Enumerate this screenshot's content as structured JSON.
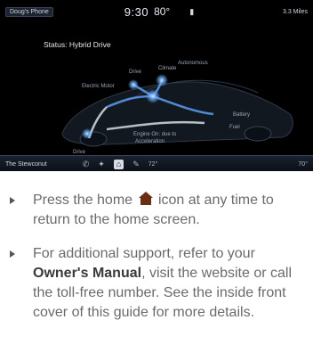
{
  "screen": {
    "top_left": "Doug's Phone",
    "time": "9:30",
    "temp": "80°",
    "top_right": "3.3 Miles",
    "status": "Status: Hybrid Drive",
    "labels": {
      "autonomy": "Autonomous",
      "drive": "Drive",
      "climate": "Climate",
      "electric_motor": "Electric Motor",
      "battery": "Battery",
      "fuel": "Fuel",
      "wheels": "Drive",
      "engine_note_1": "Engine On: due to",
      "engine_note_2": "Acceleration"
    },
    "bottom_left": "The Stewconut",
    "bottom_temp": "72°",
    "bottom_right": "70°"
  },
  "bullets": {
    "b1_before": "Press the home",
    "b1_after": "icon at any time to return to the home screen.",
    "b2_before": "For additional support, refer to your",
    "b2_bold": "Owner's Manual",
    "b2_after": ", visit the website or call the toll-free number. See the inside front cover of this guide for more details."
  },
  "colors": {
    "home_icon": "#6b2e12",
    "flow": "#5fa8ff",
    "text": "#6b6b6b"
  }
}
